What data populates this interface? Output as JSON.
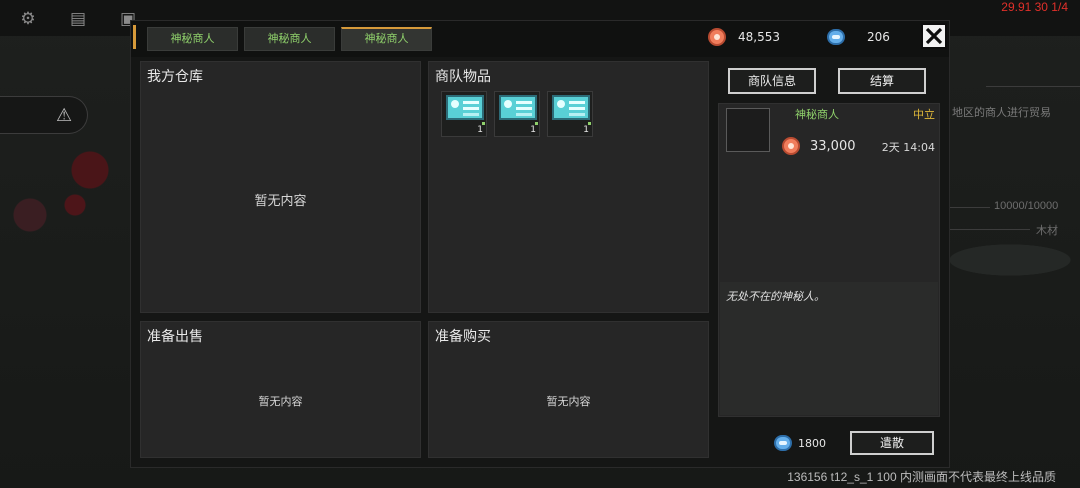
{
  "debug": {
    "fps_text": "29.91 30 1/4",
    "build_text": "136156 t12_s_1 100  内测画面不代表最终上线品质"
  },
  "background": {
    "side_texts": [
      "地区的商人进行贸易",
      "10000/10000",
      "木材"
    ],
    "icons": [
      "gear-icon",
      "chat-icon",
      "inventory-icon"
    ],
    "warning_icon": "warning-icon"
  },
  "tabs": [
    {
      "label": "神秘商人",
      "active": false
    },
    {
      "label": "神秘商人",
      "active": false
    },
    {
      "label": "神秘商人",
      "active": true
    }
  ],
  "currencies": {
    "coins": {
      "icon": "coin-icon",
      "value": "48,553"
    },
    "gems": {
      "icon": "gem-icon",
      "value": "206"
    }
  },
  "panels": {
    "my_warehouse": {
      "title": "我方仓库",
      "empty": "暂无内容"
    },
    "caravan_items": {
      "title": "商队物品",
      "items": [
        {
          "icon": "blueprint-card-icon",
          "count": "1"
        },
        {
          "icon": "blueprint-card-icon",
          "count": "1"
        },
        {
          "icon": "blueprint-card-icon",
          "count": "1"
        }
      ]
    },
    "prepare_sell": {
      "title": "准备出售",
      "empty": "暂无内容"
    },
    "prepare_buy": {
      "title": "准备购买",
      "empty": "暂无内容"
    }
  },
  "side": {
    "info_button": "商队信息",
    "settle_button": "结算",
    "merchant_name": "神秘商人",
    "attitude": "中立",
    "funds": "33,000",
    "time_left": "2天 14:04",
    "description": "无处不在的神秘人。",
    "reroll_cost": "1800",
    "dismiss_button": "遣散"
  },
  "colors": {
    "accent_green": "#8fd06b",
    "accent_yellow": "#e0b93a",
    "tab_marker": "#d79a3a",
    "coin": "#f07d5c",
    "gem": "#64aeea",
    "debug_red": "#e0302a"
  }
}
